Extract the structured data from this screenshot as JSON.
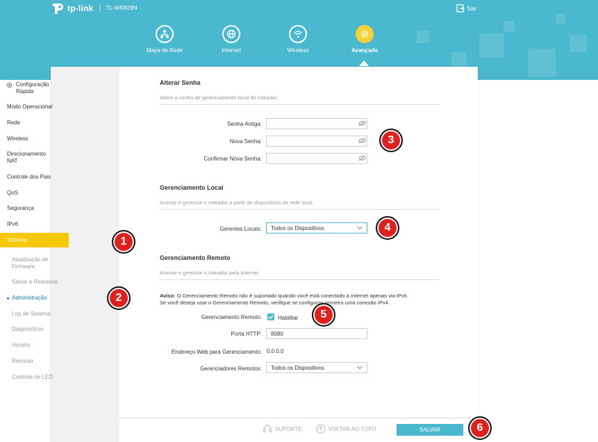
{
  "header": {
    "brand": "tp-link",
    "separator": "|",
    "model": "TL-WR829N",
    "logout_label": "Sair"
  },
  "nav": {
    "items": [
      {
        "label": "Mapa de Rede",
        "icon": "network-map-icon"
      },
      {
        "label": "Internet",
        "icon": "globe-icon"
      },
      {
        "label": "Wireless",
        "icon": "wifi-icon"
      },
      {
        "label": "Avançado",
        "icon": "gear-icon",
        "active": true
      }
    ]
  },
  "sidebar": {
    "items": [
      {
        "label": "Configuração Rápida"
      },
      {
        "label": "Modo Operacional"
      },
      {
        "label": "Rede"
      },
      {
        "label": "Wireless"
      },
      {
        "label": "Direcionamento NAT"
      },
      {
        "label": "Controle dos Pais"
      },
      {
        "label": "QoS"
      },
      {
        "label": "Segurança"
      },
      {
        "label": "IPv6"
      },
      {
        "label": "Sistema",
        "active": true
      }
    ],
    "sub_items": [
      {
        "label": "Atualização de Firmware"
      },
      {
        "label": "Salvar e Restaurar"
      },
      {
        "label": "Administração",
        "current": true
      },
      {
        "label": "Log de Sistema"
      },
      {
        "label": "Diagnósticos"
      },
      {
        "label": "Horário"
      },
      {
        "label": "Reiniciar"
      },
      {
        "label": "Controle de LED"
      }
    ]
  },
  "password_section": {
    "title": "Alterar Senha",
    "description": "Altere a senha de gerenciamento local do roteador.",
    "old_label": "Senha Antiga:",
    "new_label": "Nova Senha:",
    "confirm_label": "Confirmar Nova Senha:",
    "old_value": "",
    "new_value": "",
    "confirm_value": ""
  },
  "local_section": {
    "title": "Gerenciamento Local",
    "description": "Acesse e gerencie o roteador a partir de dispositivos de rede local.",
    "managers_label": "Gerentes Locais:",
    "managers_value": "Todos os Dispositivos"
  },
  "remote_section": {
    "title": "Gerenciamento Remoto",
    "description": "Acesse e gerencie o roteador pela Internet.",
    "warning_bold": "Aviso:",
    "warning_line1": "O Gerenciamento Remoto não é suportado quando você está conectado à Internet apenas via IPv6.",
    "warning_line2": "Se você deseja usar o Gerenciamento Remoto, verifique se configurou primeiro uma conexão IPv4.",
    "remote_label": "Gerenciamento Remoto:",
    "enable_label": "Habilitar",
    "enabled": true,
    "port_label": "Porta HTTP:",
    "port_value": "8080",
    "address_label": "Endereço Web para Gerenciamento:",
    "address_value": "0.0.0.0",
    "managers_label": "Gerenciadores Remotos:",
    "managers_value": "Todos os Dispositivos"
  },
  "footer": {
    "support_label": "SUPORTE",
    "top_label": "VOLTAR AO TOPO",
    "save_label": "SALVAR"
  },
  "badges": [
    "1",
    "2",
    "3",
    "4",
    "5",
    "6"
  ],
  "colors": {
    "header": "#4ab8cf",
    "accent": "#f5c800",
    "badge": "#e0201c",
    "button": "#4ab8cf"
  }
}
